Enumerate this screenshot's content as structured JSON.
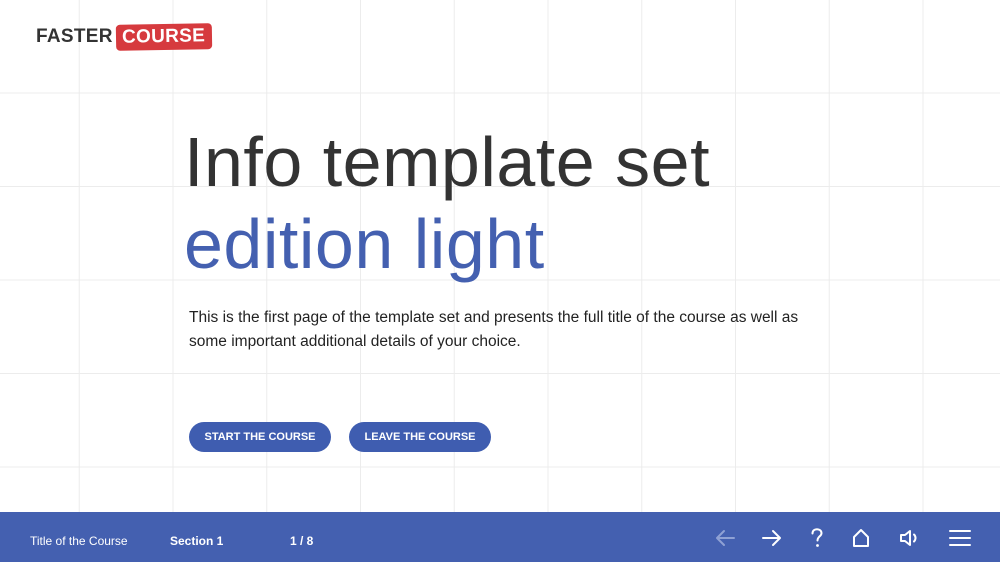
{
  "logo": {
    "part1": "FASTER",
    "part2": "COURSE"
  },
  "heading": {
    "line1": "Info template set",
    "line2": "edition light"
  },
  "description": "This is the first page of the template set and presents the full title of the course as well as some important additional details of your choice.",
  "buttons": {
    "start": "START THE COURSE",
    "leave": "LEAVE THE COURSE"
  },
  "footer": {
    "course_title": "Title of the Course",
    "section": "Section 1",
    "page": "1 / 8"
  },
  "nav_icons": [
    "back-arrow-icon",
    "forward-arrow-icon",
    "help-icon",
    "home-icon",
    "volume-icon",
    "menu-icon"
  ],
  "colors": {
    "accent": "#4460b0",
    "button": "#3f5db0",
    "logo_red": "#d63a3e",
    "title_dark": "#333333"
  }
}
